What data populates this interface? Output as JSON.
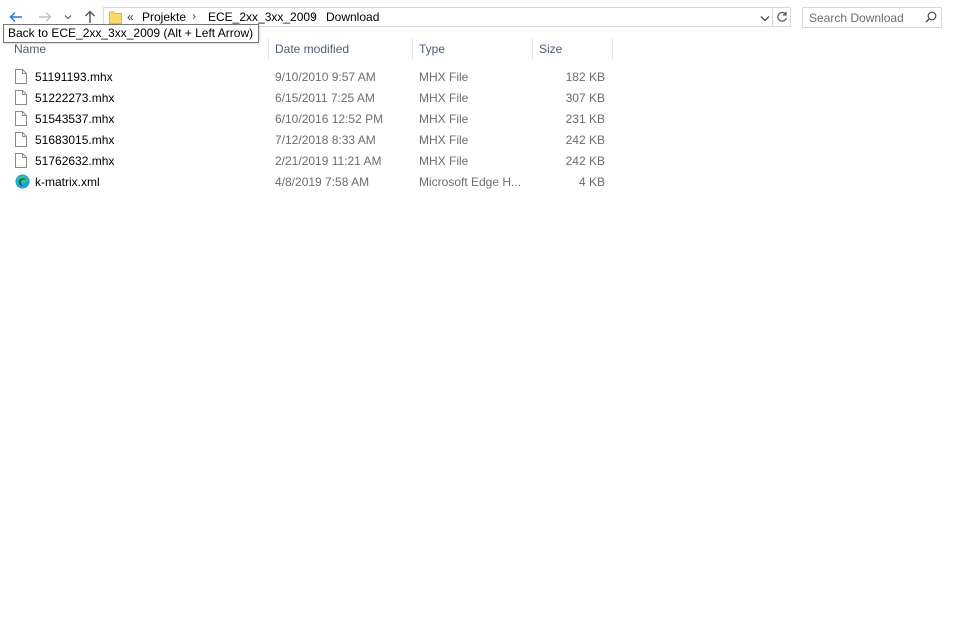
{
  "nav": {
    "tooltip": "Back to ECE_2xx_3xx_2009 (Alt + Left Arrow)",
    "address": {
      "overflow_chevron": "«",
      "crumbs": [
        "Projekte",
        "ECE_2xx_3xx_2009",
        "Download"
      ],
      "separator": "›"
    },
    "search": {
      "placeholder": "Search Download"
    }
  },
  "columns": {
    "name": "Name",
    "date": "Date modified",
    "type": "Type",
    "size": "Size"
  },
  "files": [
    {
      "name": "51191193.mhx",
      "date": "9/10/2010 9:57 AM",
      "type": "MHX File",
      "size": "182 KB",
      "icon": "file-icon"
    },
    {
      "name": "51222273.mhx",
      "date": "6/15/2011 7:25 AM",
      "type": "MHX File",
      "size": "307 KB",
      "icon": "file-icon"
    },
    {
      "name": "51543537.mhx",
      "date": "6/10/2016 12:52 PM",
      "type": "MHX File",
      "size": "231 KB",
      "icon": "file-icon"
    },
    {
      "name": "51683015.mhx",
      "date": "7/12/2018 8:33 AM",
      "type": "MHX File",
      "size": "242 KB",
      "icon": "file-icon"
    },
    {
      "name": "51762632.mhx",
      "date": "2/21/2019 11:21 AM",
      "type": "MHX File",
      "size": "242 KB",
      "icon": "file-icon"
    },
    {
      "name": "k-matrix.xml",
      "date": "4/8/2019 7:58 AM",
      "type": "Microsoft Edge H...",
      "size": "4 KB",
      "icon": "edge-icon"
    }
  ],
  "colors": {
    "accent": "#1e78d4",
    "header_text": "#4c607a",
    "secondary_text": "#6d6d6d"
  }
}
